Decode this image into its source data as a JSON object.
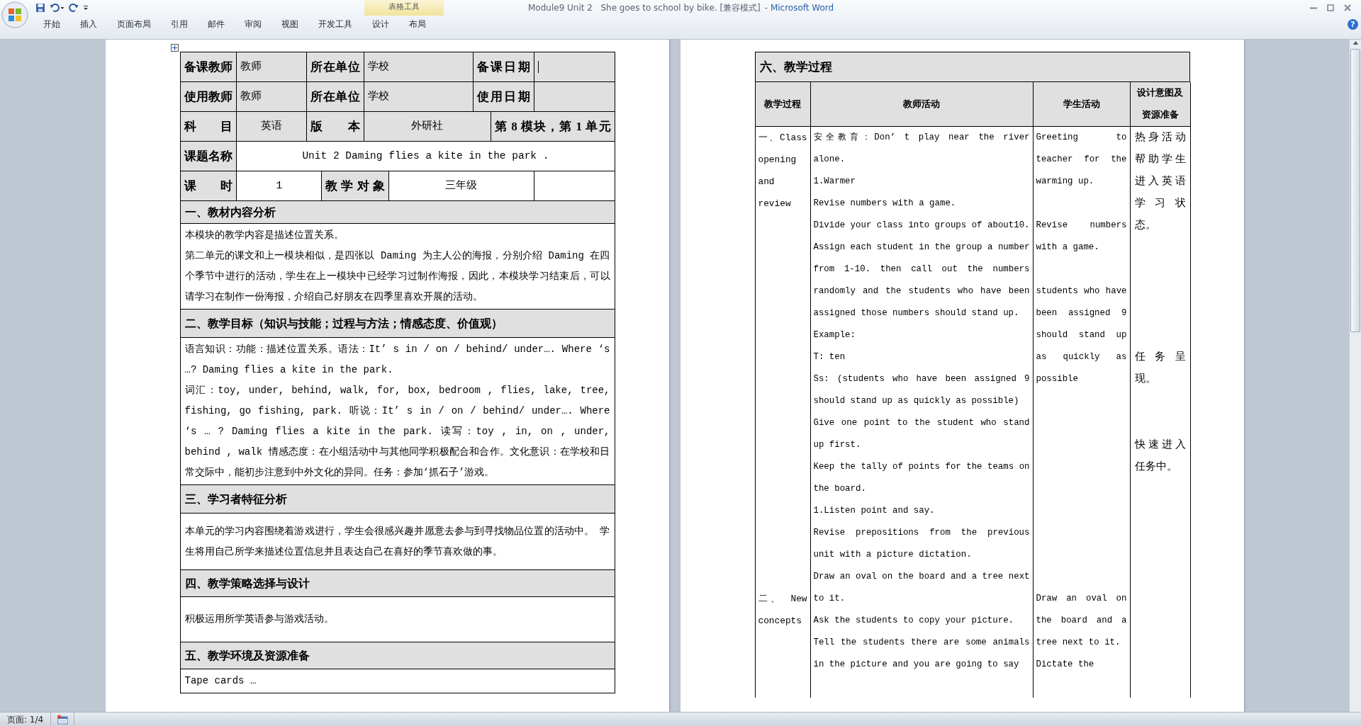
{
  "window": {
    "title": "Module9 Unit 2   She goes to school by bike. [兼容模式]",
    "app_name": "- Microsoft Word",
    "tool_group": "表格工具"
  },
  "ribbon_tabs": [
    {
      "label": "开始",
      "selected": false
    },
    {
      "label": "插入",
      "selected": false
    },
    {
      "label": "页面布局",
      "selected": false
    },
    {
      "label": "引用",
      "selected": false
    },
    {
      "label": "邮件",
      "selected": false
    },
    {
      "label": "审阅",
      "selected": false
    },
    {
      "label": "视图",
      "selected": false
    },
    {
      "label": "开发工具",
      "selected": false
    },
    {
      "label": "设计",
      "selected": false
    },
    {
      "label": "布局",
      "selected": false
    }
  ],
  "help_button": "?",
  "left_page": {
    "info_rows": [
      {
        "cells": [
          {
            "text": "备课教师",
            "kind": "label",
            "shaded": true,
            "cursor": false
          },
          {
            "text": "教师",
            "kind": "value",
            "shaded": true,
            "cursor": false
          },
          {
            "text": "所在单位",
            "kind": "label",
            "shaded": true,
            "cursor": false
          },
          {
            "text": "学校",
            "kind": "value",
            "shaded": true,
            "cursor": false
          },
          {
            "text": "备课日期",
            "kind": "label",
            "shaded": true,
            "cursor": false
          },
          {
            "kind": "value",
            "shaded": true,
            "cursor": true
          }
        ]
      },
      {
        "cells": [
          {
            "text": "使用教师",
            "kind": "label",
            "shaded": true,
            "cursor": false
          },
          {
            "text": "教师",
            "kind": "value",
            "shaded": true,
            "cursor": false
          },
          {
            "text": "所在单位",
            "kind": "label",
            "shaded": true,
            "cursor": false
          },
          {
            "text": "学校",
            "kind": "value",
            "shaded": true,
            "cursor": false
          },
          {
            "text": "使用日期",
            "kind": "label",
            "shaded": true,
            "cursor": false
          },
          {
            "kind": "value",
            "shaded": true,
            "cursor": false
          }
        ]
      },
      {
        "cells": [
          {
            "text": "科 目",
            "kind": "label",
            "shaded": true,
            "cursor": false
          },
          {
            "text": "英语",
            "kind": "value",
            "shaded": true,
            "cursor": false
          },
          {
            "text": "版 本",
            "kind": "label",
            "shaded": true,
            "cursor": false
          },
          {
            "text": "外研社",
            "kind": "value",
            "shaded": true,
            "cursor": false
          },
          {
            "text": "第 8 模块，第 1 单元",
            "kind": "label",
            "shaded": true,
            "cursor": false
          }
        ]
      },
      {
        "cells": [
          {
            "text": "课题名称",
            "kind": "label",
            "shaded": true,
            "cursor": false
          },
          {
            "text": "Unit 2 Daming flies a kite in the park .",
            "kind": "value",
            "shaded": false,
            "cursor": false
          }
        ]
      },
      {
        "cells": [
          {
            "text": "课 时",
            "kind": "label",
            "shaded": true,
            "cursor": false
          },
          {
            "text": "1",
            "kind": "value",
            "shaded": false,
            "cursor": false
          },
          {
            "text": "教学对象",
            "kind": "label",
            "shaded": true,
            "cursor": false
          },
          {
            "text": "三年级",
            "kind": "value",
            "shaded": false,
            "cursor": false
          },
          {
            "kind": "value",
            "shaded": false,
            "cursor": false
          }
        ]
      }
    ],
    "sections": [
      {
        "heading": "一、教材内容分析",
        "paragraphs": [
          "本模块的教学内容是描述位置关系。",
          "第二单元的课文和上一模块相似，是四张以 Daming 为主人公的海报，分别介绍 Daming 在四个季节中进行的活动，学生在上一模块中已经学习过制作海报，因此，本模块学习结束后，可以请学习在制作一份海报，介绍自己好朋友在四季里喜欢开展的活动。"
        ]
      },
      {
        "heading": "二、教学目标（知识与技能；过程与方法；情感态度、价值观）",
        "paragraphs": [
          "语言知识：功能：描述位置关系。语法：It’ s in / on / behind/ under…. Where ‘s …? Daming flies a kite in the park.",
          "词汇：toy, under, behind, walk, for, box, bedroom , flies, lake, tree, fishing, go fishing, park. 听说：It’ s in / on / behind/ under…. Where ‘s  … ? Daming flies a kite in the park. 读写：toy , in,  on , under,  behind , walk 情感态度：在小组活动中与其他同学积极配合和合作。文化意识：在学校和日常交际中，能初步注意到中外文化的异同。任务：参加‘抓石子’游戏。"
        ]
      },
      {
        "heading": "三、学习者特征分析",
        "paragraphs": [
          "本单元的学习内容围绕着游戏进行，学生会很感兴趣并愿意去参与到寻找物品位置的活动中。 学生将用自己所学来描述位置信息并且表达自己在喜好的季节喜欢做的事。"
        ]
      },
      {
        "heading": "四、教学策略选择与设计",
        "paragraphs": [
          "积极运用所学英语参与游戏活动。"
        ]
      },
      {
        "heading": "五、教学环境及资源准备",
        "paragraphs": [
          "Tape  cards …"
        ]
      }
    ]
  },
  "right_page": {
    "heading": "六、教学过程",
    "columns": [
      "教学过程",
      "教师活动",
      "学生活动",
      "设计意图及资源准备"
    ],
    "cells": [
      [
        {
          "kind": "text",
          "text": "一、Class opening and review"
        },
        {
          "kind": "empty"
        },
        {
          "kind": "empty"
        },
        {
          "kind": "empty"
        },
        {
          "kind": "empty"
        },
        {
          "kind": "empty"
        },
        {
          "kind": "empty"
        },
        {
          "kind": "empty"
        },
        {
          "kind": "empty"
        },
        {
          "kind": "empty"
        },
        {
          "kind": "empty"
        },
        {
          "kind": "empty"
        },
        {
          "kind": "empty"
        },
        {
          "kind": "empty"
        },
        {
          "kind": "empty"
        },
        {
          "kind": "empty"
        },
        {
          "kind": "empty"
        },
        {
          "kind": "empty"
        },
        {
          "kind": "text",
          "text": "二、 New concepts"
        },
        {
          "kind": "empty"
        },
        {
          "kind": "empty"
        },
        {
          "kind": "empty"
        }
      ],
      [
        {
          "kind": "text",
          "text": "安全教育：Don’ t play near the river alone."
        },
        {
          "kind": "text",
          "text": "1.Warmer"
        },
        {
          "kind": "text",
          "text": "Revise numbers with a game."
        },
        {
          "kind": "text",
          "text": "Divide your class into groups of about10. Assign each student in the group a number from 1-10. then call out the numbers randomly and the students who have been assigned those numbers should stand up."
        },
        {
          "kind": "text",
          "text": "Example:"
        },
        {
          "kind": "text",
          "text": "T: ten"
        },
        {
          "kind": "text",
          "text": "Ss: (students who  have been assigned 9 should stand up as quickly as possible)"
        },
        {
          "kind": "text",
          "text": "Give one point to the student who stand up first."
        },
        {
          "kind": "text",
          "text": "Keep the tally of points for the teams on the board."
        },
        {
          "kind": "text",
          "text": "1.Listen point and say."
        },
        {
          "kind": "text",
          "text": "Revise prepositions from the previous unit with a picture dictation."
        },
        {
          "kind": "text",
          "text": "Draw an oval on the board and a tree next to it."
        },
        {
          "kind": "text",
          "text": "Ask the students to copy your picture."
        },
        {
          "kind": "text",
          "text": "Tell the students there are some animals in the picture and you are going to say"
        }
      ],
      [
        {
          "kind": "text",
          "text": "Greeting to teacher for the warming up."
        },
        {
          "kind": "empty"
        },
        {
          "kind": "text",
          "text": "Revise numbers with a game."
        },
        {
          "kind": "empty"
        },
        {
          "kind": "text",
          "text": "students who have been assigned 9 should stand up as quickly as possible"
        },
        {
          "kind": "empty"
        },
        {
          "kind": "empty"
        },
        {
          "kind": "empty"
        },
        {
          "kind": "empty"
        },
        {
          "kind": "empty"
        },
        {
          "kind": "empty"
        },
        {
          "kind": "empty"
        },
        {
          "kind": "empty"
        },
        {
          "kind": "empty"
        },
        {
          "kind": "text",
          "text": "Draw an oval on the board and a tree next to it."
        },
        {
          "kind": "text",
          "text": "Dictate the"
        }
      ],
      [
        {
          "kind": "text",
          "text": "热身活动帮助学生进入英语学习状态。"
        },
        {
          "kind": "empty"
        },
        {
          "kind": "empty"
        },
        {
          "kind": "empty"
        },
        {
          "kind": "empty"
        },
        {
          "kind": "empty"
        },
        {
          "kind": "text",
          "text": "任务呈现。"
        },
        {
          "kind": "empty"
        },
        {
          "kind": "empty"
        },
        {
          "kind": "text",
          "text": "快速进入任务中。"
        },
        {
          "kind": "empty"
        }
      ]
    ]
  },
  "status_bar": {
    "page": "页面: 1/4"
  }
}
